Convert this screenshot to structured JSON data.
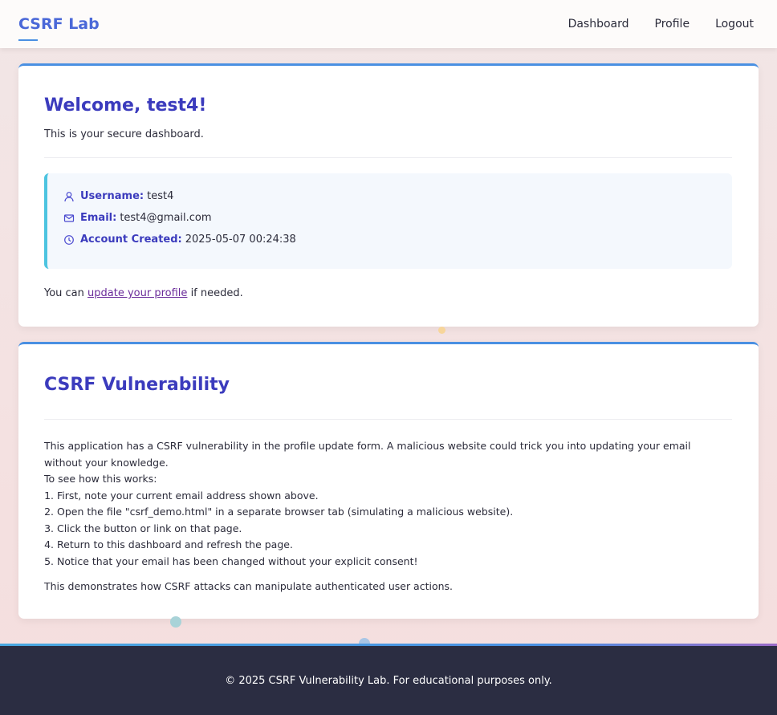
{
  "nav": {
    "brand": "CSRF Lab",
    "links": [
      "Dashboard",
      "Profile",
      "Logout"
    ]
  },
  "welcome": {
    "title": "Welcome, test4!",
    "subtitle": "This is your secure dashboard.",
    "info": {
      "username_label": "Username:",
      "username": "test4",
      "email_label": "Email:",
      "email": "test4@gmail.com",
      "created_label": "Account Created:",
      "created": "2025-05-07 00:24:38"
    },
    "update_prefix": "You can",
    "update_link": "update your profile",
    "update_suffix": "if needed."
  },
  "csrf": {
    "title": "CSRF Vulnerability",
    "intro": "This application has a CSRF vulnerability in the profile update form. A malicious website could trick you into updating your email without your knowledge.",
    "how_label": "To see how this works:",
    "steps": [
      "First, note your current email address shown above.",
      "Open the file \"csrf_demo.html\" in a separate browser tab (simulating a malicious website).",
      "Click the button or link on that page.",
      "Return to this dashboard and refresh the page.",
      "Notice that your email has been changed without your explicit consent!"
    ],
    "closing": "This demonstrates how CSRF attacks can manipulate authenticated user actions."
  },
  "footer": {
    "text": "© 2025 CSRF Vulnerability Lab. For educational purposes only."
  },
  "colors": {
    "accent": "#4a90e2",
    "heading": "#3b3bbd",
    "footer_bg": "#2b2d42"
  },
  "icons": {
    "username": "user-icon",
    "email": "mail-icon",
    "created": "clock-icon"
  }
}
